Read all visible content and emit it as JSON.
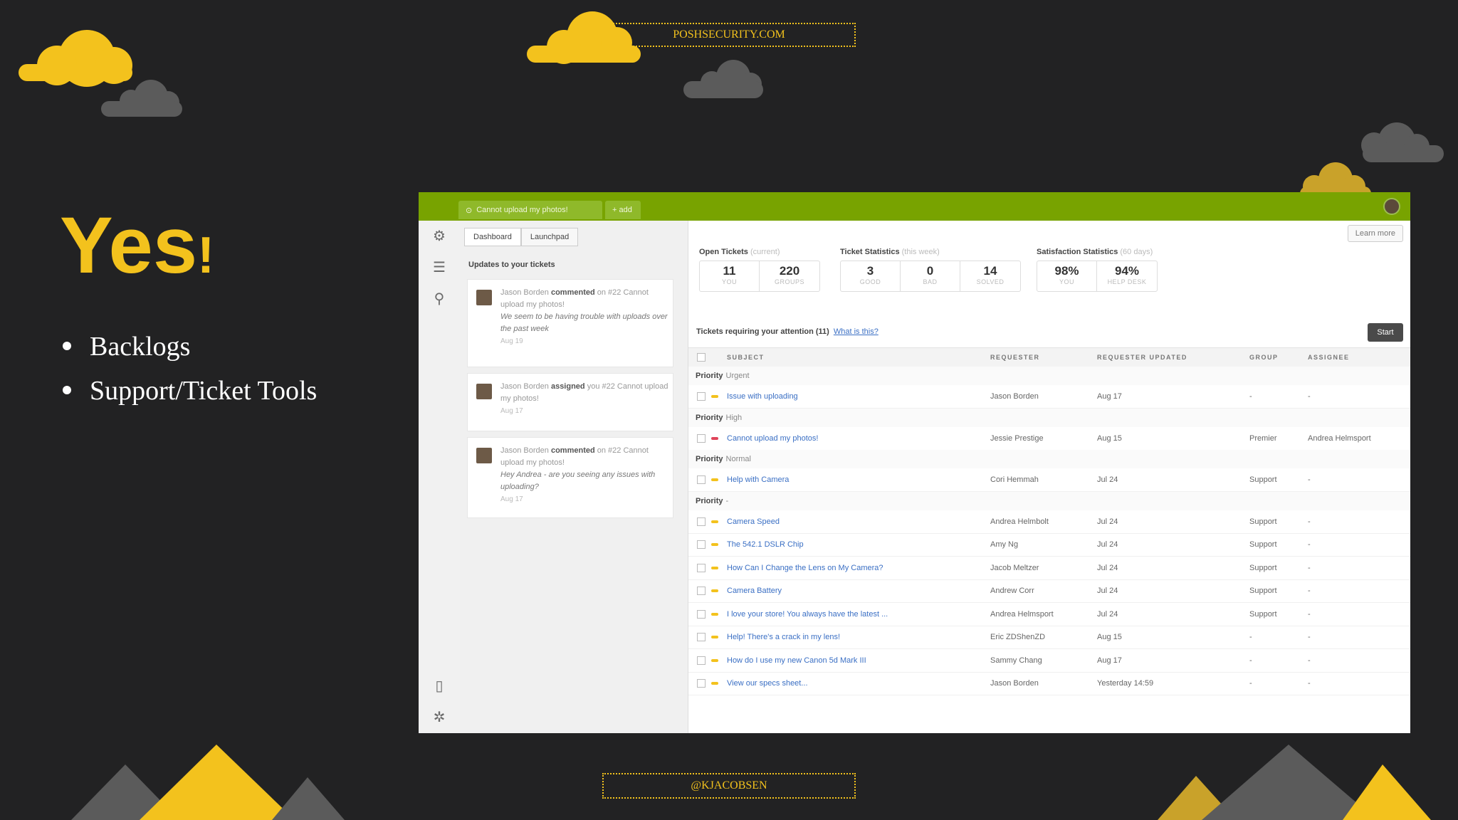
{
  "slide": {
    "site": "POSHSECURITY.COM",
    "handle": "@KJACOBSEN",
    "title_main": "Yes",
    "title_bang": "!",
    "bullets": [
      "Backlogs",
      "Support/Ticket Tools"
    ]
  },
  "colors": {
    "background": "#222223",
    "accent": "#f3c21d",
    "cloud_grey": "#5b5b5b",
    "app_green": "#78a300",
    "link_blue": "#3a6fc4"
  },
  "app": {
    "top_tabs": [
      "Cannot upload my photos!",
      "+ add"
    ],
    "sub_tabs": [
      "Dashboard",
      "Launchpad"
    ],
    "learn_more": "Learn more",
    "nav_icons": [
      "gear-icon",
      "list-icon",
      "search-icon",
      "book-icon",
      "settings-icon"
    ],
    "updates": {
      "title": "Updates to your tickets",
      "items": [
        {
          "actor": "Jason Borden",
          "verb": "commented",
          "rest": "on #22 Cannot upload my photos!",
          "quote": "We seem to be having trouble with uploads over the past week",
          "date": "Aug 19"
        },
        {
          "actor": "Jason Borden",
          "verb": "assigned",
          "rest": "you #22 Cannot upload my photos!",
          "quote": "",
          "date": "Aug 17"
        },
        {
          "actor": "Jason Borden",
          "verb": "commented",
          "rest": "on #22 Cannot upload my photos!",
          "quote": "Hey Andrea - are you seeing any issues with uploading?",
          "date": "Aug 17"
        }
      ]
    },
    "stats": [
      {
        "title": "Open Tickets",
        "sub": "(current)",
        "boxes": [
          {
            "num": "11",
            "label": "YOU"
          },
          {
            "num": "220",
            "label": "GROUPS"
          }
        ]
      },
      {
        "title": "Ticket Statistics",
        "sub": "(this week)",
        "boxes": [
          {
            "num": "3",
            "label": "GOOD"
          },
          {
            "num": "0",
            "label": "BAD"
          },
          {
            "num": "14",
            "label": "SOLVED"
          }
        ]
      },
      {
        "title": "Satisfaction Statistics",
        "sub": "(60 days)",
        "boxes": [
          {
            "num": "98%",
            "label": "YOU"
          },
          {
            "num": "94%",
            "label": "HELP DESK"
          }
        ]
      }
    ],
    "attention": "Tickets requiring your attention (11)",
    "attention_link": "What is this?",
    "start_label": "Start",
    "columns": [
      "SUBJECT",
      "REQUESTER",
      "REQUESTER UPDATED",
      "GROUP",
      "ASSIGNEE"
    ],
    "groups": [
      {
        "label": "Priority",
        "value": "Urgent",
        "rows": [
          {
            "subject": "Issue with uploading",
            "requester": "Jason Borden",
            "updated": "Aug 17",
            "group": "-",
            "assignee": "-",
            "color": "#f3c21d"
          }
        ]
      },
      {
        "label": "Priority",
        "value": "High",
        "rows": [
          {
            "subject": "Cannot upload my photos!",
            "requester": "Jessie Prestige",
            "updated": "Aug 15",
            "group": "Premier",
            "assignee": "Andrea Helmsport",
            "color": "#e0445a"
          }
        ]
      },
      {
        "label": "Priority",
        "value": "Normal",
        "rows": [
          {
            "subject": "Help with Camera",
            "requester": "Cori Hemmah",
            "updated": "Jul 24",
            "group": "Support",
            "assignee": "-",
            "color": "#f3c21d"
          }
        ]
      },
      {
        "label": "Priority",
        "value": "-",
        "rows": [
          {
            "subject": "Camera Speed",
            "requester": "Andrea Helmbolt",
            "updated": "Jul 24",
            "group": "Support",
            "assignee": "-",
            "color": "#f3c21d"
          },
          {
            "subject": "The 542.1 DSLR Chip",
            "requester": "Amy Ng",
            "updated": "Jul 24",
            "group": "Support",
            "assignee": "-",
            "color": "#f3c21d"
          },
          {
            "subject": "How Can I Change the Lens on My Camera?",
            "requester": "Jacob Meltzer",
            "updated": "Jul 24",
            "group": "Support",
            "assignee": "-",
            "color": "#f3c21d"
          },
          {
            "subject": "Camera Battery",
            "requester": "Andrew Corr",
            "updated": "Jul 24",
            "group": "Support",
            "assignee": "-",
            "color": "#f3c21d"
          },
          {
            "subject": "I love your store! You always have the latest ...",
            "requester": "Andrea Helmsport",
            "updated": "Jul 24",
            "group": "Support",
            "assignee": "-",
            "color": "#f3c21d"
          },
          {
            "subject": "Help! There's a crack in my lens!",
            "requester": "Eric ZDShenZD",
            "updated": "Aug 15",
            "group": "-",
            "assignee": "-",
            "color": "#f3c21d"
          },
          {
            "subject": "How do I use my new Canon 5d Mark III",
            "requester": "Sammy Chang",
            "updated": "Aug 17",
            "group": "-",
            "assignee": "-",
            "color": "#f3c21d"
          },
          {
            "subject": "View our specs sheet...",
            "requester": "Jason Borden",
            "updated": "Yesterday 14:59",
            "group": "-",
            "assignee": "-",
            "color": "#f3c21d"
          }
        ]
      }
    ]
  }
}
